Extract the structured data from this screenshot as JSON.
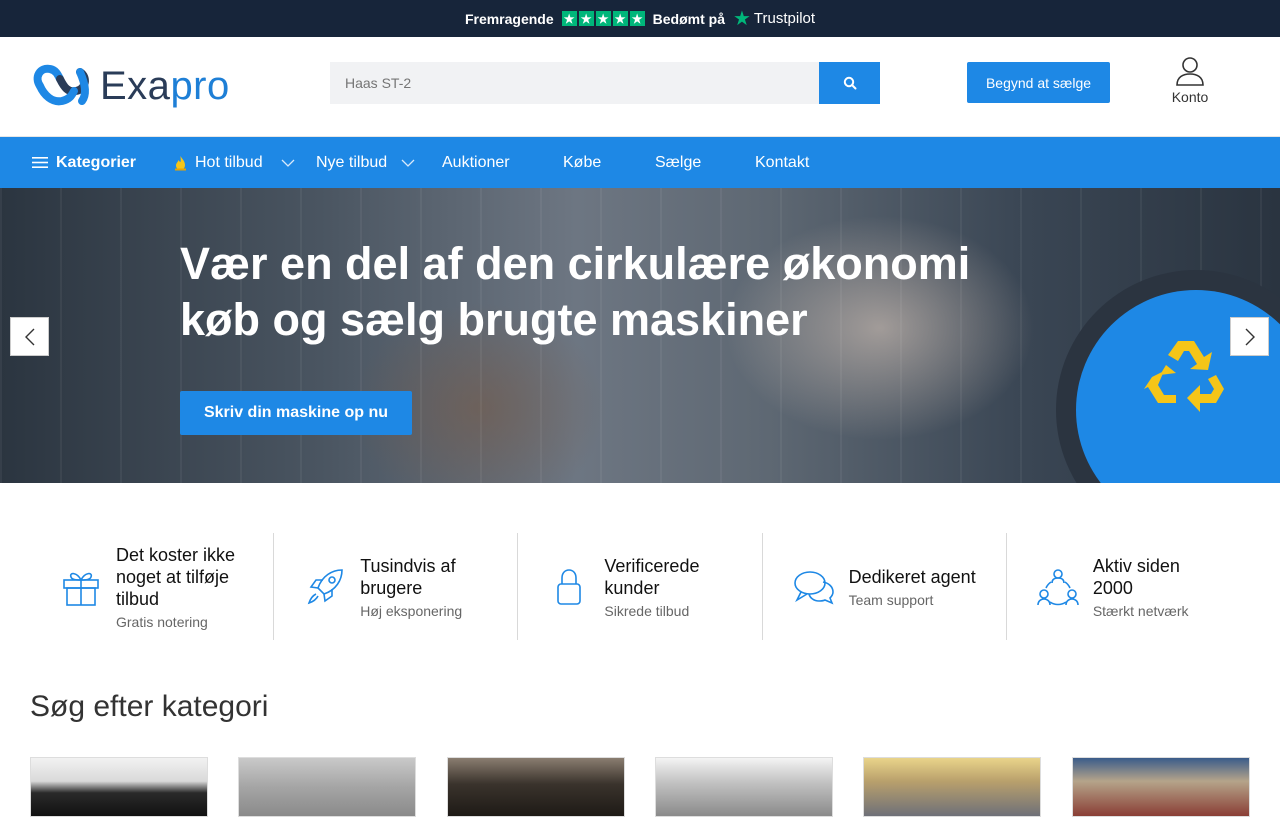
{
  "trustbar": {
    "rating_text": "Fremragende",
    "rated_on": "Bedømt på",
    "brand": "Trustpilot",
    "stars": 5,
    "star_color": "#00b67a"
  },
  "header": {
    "logo_text_a": "Exa",
    "logo_text_b": "pro",
    "search_placeholder": "Haas ST-2",
    "search_icon": "search-icon",
    "sell_button": "Begynd at sælge",
    "account_label": "Konto"
  },
  "nav": {
    "categories": "Kategorier",
    "hot": "Hot tilbud",
    "new": "Nye tilbud",
    "auctions": "Auktioner",
    "buy": "Købe",
    "sell": "Sælge",
    "contact": "Kontakt"
  },
  "hero": {
    "title_line1": "Vær en del af den cirkulære økonomi",
    "title_line2": "køb og sælg brugte maskiner",
    "cta": "Skriv din maskine op nu"
  },
  "features": [
    {
      "icon": "gift-icon",
      "title": "Det koster ikke noget at tilføje tilbud",
      "sub": "Gratis notering"
    },
    {
      "icon": "rocket-icon",
      "title": "Tusindvis af brugere",
      "sub": "Høj eksponering"
    },
    {
      "icon": "lock-icon",
      "title": "Verificerede kunder",
      "sub": "Sikrede tilbud"
    },
    {
      "icon": "chat-icon",
      "title": "Dedikeret agent",
      "sub": "Team support"
    },
    {
      "icon": "network-icon",
      "title": "Aktiv siden 2000",
      "sub": "Stærkt netværk"
    }
  ],
  "categories_section": {
    "title": "Søg efter kategori"
  },
  "colors": {
    "primary": "#1e88e5",
    "dark": "#17253a",
    "accent_yellow": "#f5c518"
  }
}
